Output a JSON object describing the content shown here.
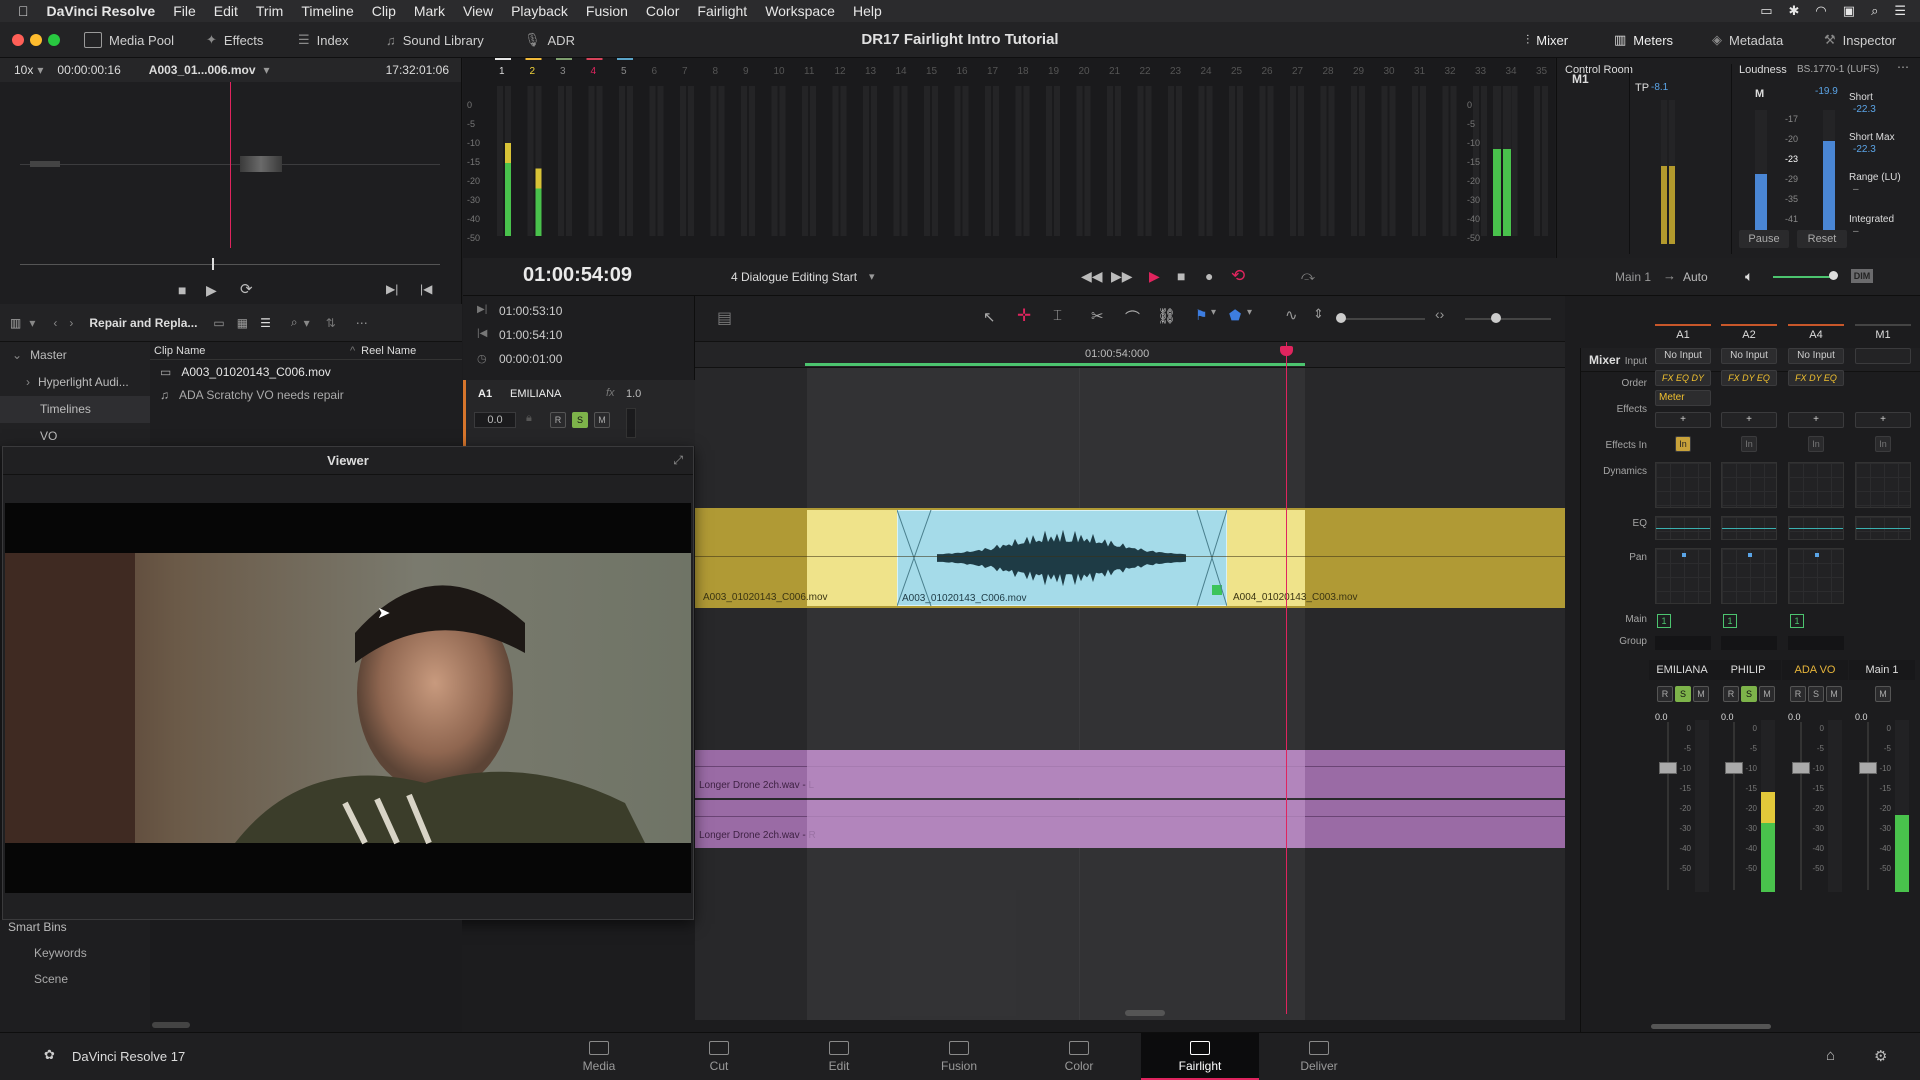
{
  "menubar": {
    "app": "DaVinci Resolve",
    "items": [
      "File",
      "Edit",
      "Trim",
      "Timeline",
      "Clip",
      "Mark",
      "View",
      "Playback",
      "Fusion",
      "Color",
      "Fairlight",
      "Workspace",
      "Help"
    ]
  },
  "toolbar": {
    "media_pool": "Media Pool",
    "effects": "Effects",
    "index": "Index",
    "sound_library": "Sound Library",
    "adr": "ADR",
    "project_title": "DR17 Fairlight Intro Tutorial",
    "mixer": "Mixer",
    "meters": "Meters",
    "metadata": "Metadata",
    "inspector": "Inspector"
  },
  "source": {
    "zoom": "10x",
    "timecode": "00:00:00:16",
    "clip": "A003_01...006.mov",
    "duration": "17:32:01:06"
  },
  "meters": {
    "channels": [
      "1",
      "2",
      "3",
      "4",
      "5",
      "6",
      "7",
      "8",
      "9",
      "10",
      "11",
      "12",
      "13",
      "14",
      "15",
      "16",
      "17",
      "18",
      "19",
      "20",
      "21",
      "22",
      "23",
      "24",
      "25",
      "26",
      "27",
      "28",
      "29",
      "30",
      "31",
      "32",
      "33",
      "34",
      "35"
    ],
    "scale": [
      "0",
      "-5",
      "-10",
      "-15",
      "-20",
      "-30",
      "-40",
      "-50"
    ],
    "m1_label": "M1",
    "m1_scale": [
      "0",
      "-5",
      "-10",
      "-15",
      "-20",
      "-30",
      "-40",
      "-50"
    ]
  },
  "control_room": {
    "title": "Control Room",
    "tp_label": "TP",
    "tp_value": "-8.1",
    "loudness_label": "Loudness",
    "standard": "BS.1770-1 (LUFS)",
    "m_label": "M",
    "m_value": "-19.9",
    "scale": [
      "-17",
      "-20",
      "-23",
      "-29",
      "-35",
      "-41"
    ],
    "short_label": "Short",
    "short_value": "-22.3",
    "short_max_label": "Short Max",
    "short_max_value": "-22.3",
    "range_label": "Range (LU)",
    "range_value": "–",
    "integrated_label": "Integrated",
    "integrated_value": "–",
    "pause": "Pause",
    "reset": "Reset"
  },
  "transport": {
    "timecode": "01:00:54:09",
    "marker": "4 Dialogue Editing Start",
    "main": "Main 1",
    "auto": "Auto",
    "dim": "DIM"
  },
  "pool": {
    "bin_title": "Repair and Repla...",
    "col_clip": "Clip Name",
    "col_reel": "Reel Name",
    "bins": [
      "Master",
      "Hyperlight Audi...",
      "Timelines",
      "VO"
    ],
    "clips": [
      "A003_01020143_C006.mov",
      "ADA Scratchy VO needs repair"
    ],
    "smart_bins": "Smart Bins",
    "smart_items": [
      "Keywords",
      "Scene"
    ]
  },
  "inout": {
    "in": "01:00:53:10",
    "out": "01:00:54:10",
    "dur": "00:00:01:00"
  },
  "track": {
    "id": "A1",
    "name": "EMILIANA",
    "fx": "fx",
    "gain": "1.0",
    "volume": "0.0",
    "r": "R",
    "s": "S",
    "m": "M"
  },
  "timeline": {
    "ruler_tc": "01:00:54:000",
    "clip_left": "A003_01020143_C006.mov",
    "clip_mid": "A003_01020143_C006.mov",
    "clip_right": "A004_01020143_C003.mov",
    "drone_l": "Longer Drone 2ch.wav - L",
    "drone_r": "Longer Drone 2ch.wav - R"
  },
  "viewer": {
    "title": "Viewer"
  },
  "mixer": {
    "title": "Mixer",
    "channels": [
      "A1",
      "A2",
      "A4",
      "M1"
    ],
    "row_labels": [
      "Input",
      "Order",
      "Effects",
      "Effects In",
      "Dynamics",
      "EQ",
      "Pan",
      "Main",
      "Group"
    ],
    "input": "No Input",
    "order": [
      "FX EQ DY",
      "FX DY EQ",
      "FX DY EQ"
    ],
    "meter_fx": "Meter",
    "effects_in": "In",
    "main_num": "1",
    "names": [
      "EMILIANA",
      "PHILIP",
      "ADA VO",
      "Main 1"
    ],
    "fader_val": "0.0",
    "fader_scale": [
      "0",
      "-5",
      "-10",
      "-15",
      "-20",
      "-30",
      "-40",
      "-50"
    ]
  },
  "bottom": {
    "brand": "DaVinci Resolve 17",
    "pages": [
      "Media",
      "Cut",
      "Edit",
      "Fusion",
      "Color",
      "Fairlight",
      "Deliver"
    ],
    "active": "Fairlight"
  },
  "colors": {
    "accent_red": "#e0245e",
    "clip_yellow": "#efe38a",
    "clip_cyan": "#a5dbe9",
    "drone_purple": "#9a6ba5",
    "meter_green": "#39b54a"
  }
}
